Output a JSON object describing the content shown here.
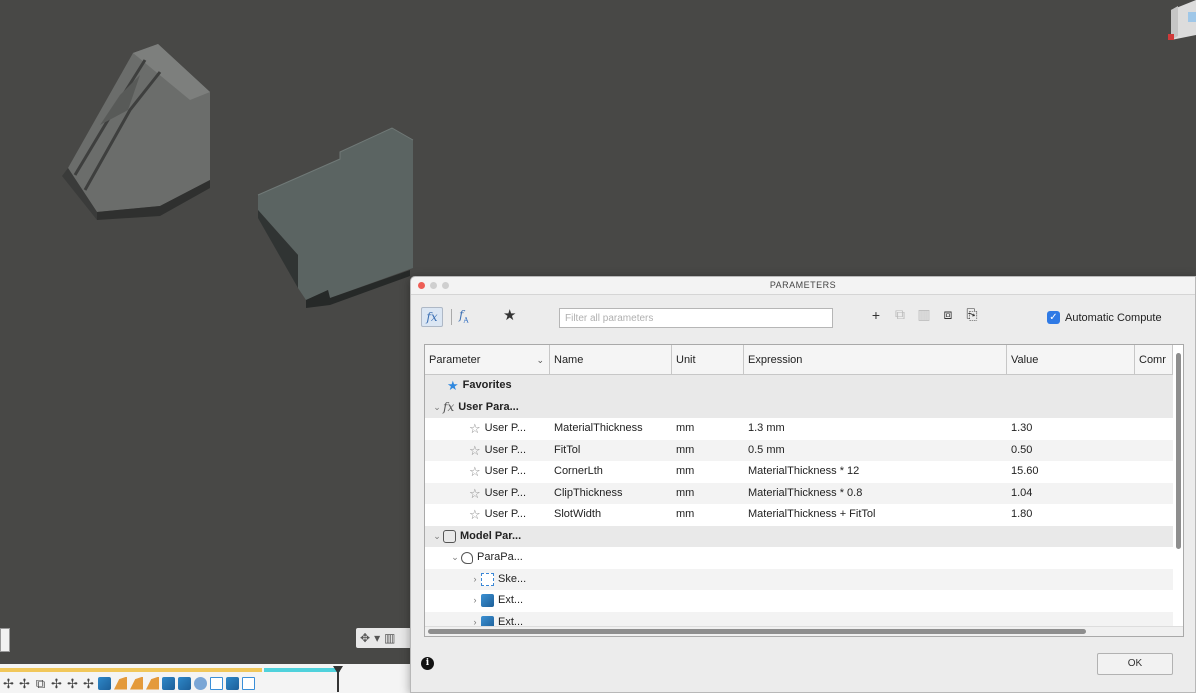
{
  "dialog": {
    "title": "PARAMETERS",
    "filter_placeholder": "Filter all parameters",
    "auto_compute_label": "Automatic Compute",
    "auto_compute_checked": true,
    "ok_label": "OK",
    "info_glyph": "i"
  },
  "toolbar_icons": {
    "fx": "fx-icon",
    "sort": "fx-sort-icon",
    "star": "star-icon",
    "add": "plus-icon",
    "copy": "copy-icon",
    "delete": "trash-icon",
    "import": "import-icon",
    "export": "export-icon"
  },
  "table": {
    "headers": {
      "parameter": "Parameter",
      "name": "Name",
      "unit": "Unit",
      "expression": "Expression",
      "value": "Value",
      "comment": "Comr"
    },
    "favorites_label": "Favorites",
    "user_group_label": "User Para...",
    "user_params": [
      {
        "type": "User P...",
        "name": "MaterialThickness",
        "unit": "mm",
        "expression": "1.3 mm",
        "value": "1.30"
      },
      {
        "type": "User P...",
        "name": "FitTol",
        "unit": "mm",
        "expression": "0.5 mm",
        "value": "0.50"
      },
      {
        "type": "User P...",
        "name": "CornerLth",
        "unit": "mm",
        "expression": "MaterialThickness * 12",
        "value": "15.60"
      },
      {
        "type": "User P...",
        "name": "ClipThickness",
        "unit": "mm",
        "expression": "MaterialThickness * 0.8",
        "value": "1.04"
      },
      {
        "type": "User P...",
        "name": "SlotWidth",
        "unit": "mm",
        "expression": "MaterialThickness + FitTol",
        "value": "1.80"
      }
    ],
    "model_group_label": "Model Par...",
    "component_label": "ParaPa...",
    "features": [
      {
        "label": "Ske...",
        "icon": "sketch-icon"
      },
      {
        "label": "Ext...",
        "icon": "extrude-icon"
      },
      {
        "label": "Ext...",
        "icon": "extrude-icon"
      }
    ]
  },
  "colors": {
    "viewport_bg": "#484846",
    "part_fill": "#6a6c6a",
    "plate_fill": "#5a6361",
    "accent_blue": "#2f7ae5",
    "timeline_yellow": "#f1c75a",
    "timeline_teal": "#4fd2dc"
  }
}
